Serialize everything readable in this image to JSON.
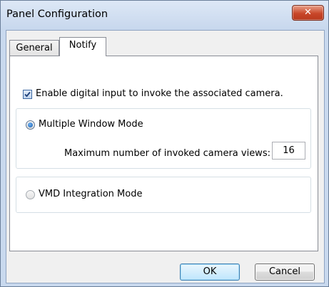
{
  "window": {
    "title": "Panel Configuration",
    "close_glyph": "✕"
  },
  "tabs": [
    {
      "label": "General",
      "active": false
    },
    {
      "label": "Notify",
      "active": true
    }
  ],
  "notify": {
    "enable_checkbox": {
      "label": "Enable digital input to invoke the associated camera.",
      "checked": true
    },
    "multiple_window": {
      "label": "Multiple Window Mode",
      "selected": true,
      "max_views_label": "Maximum number of invoked camera views:",
      "max_views_value": "16"
    },
    "vmd_integration": {
      "label": "VMD Integration Mode",
      "selected": false
    }
  },
  "buttons": {
    "ok": "OK",
    "cancel": "Cancel"
  },
  "colors": {
    "frame": "#c9d9ee",
    "close_button": "#c8472a",
    "ok_button_border": "#3c7fb1"
  }
}
